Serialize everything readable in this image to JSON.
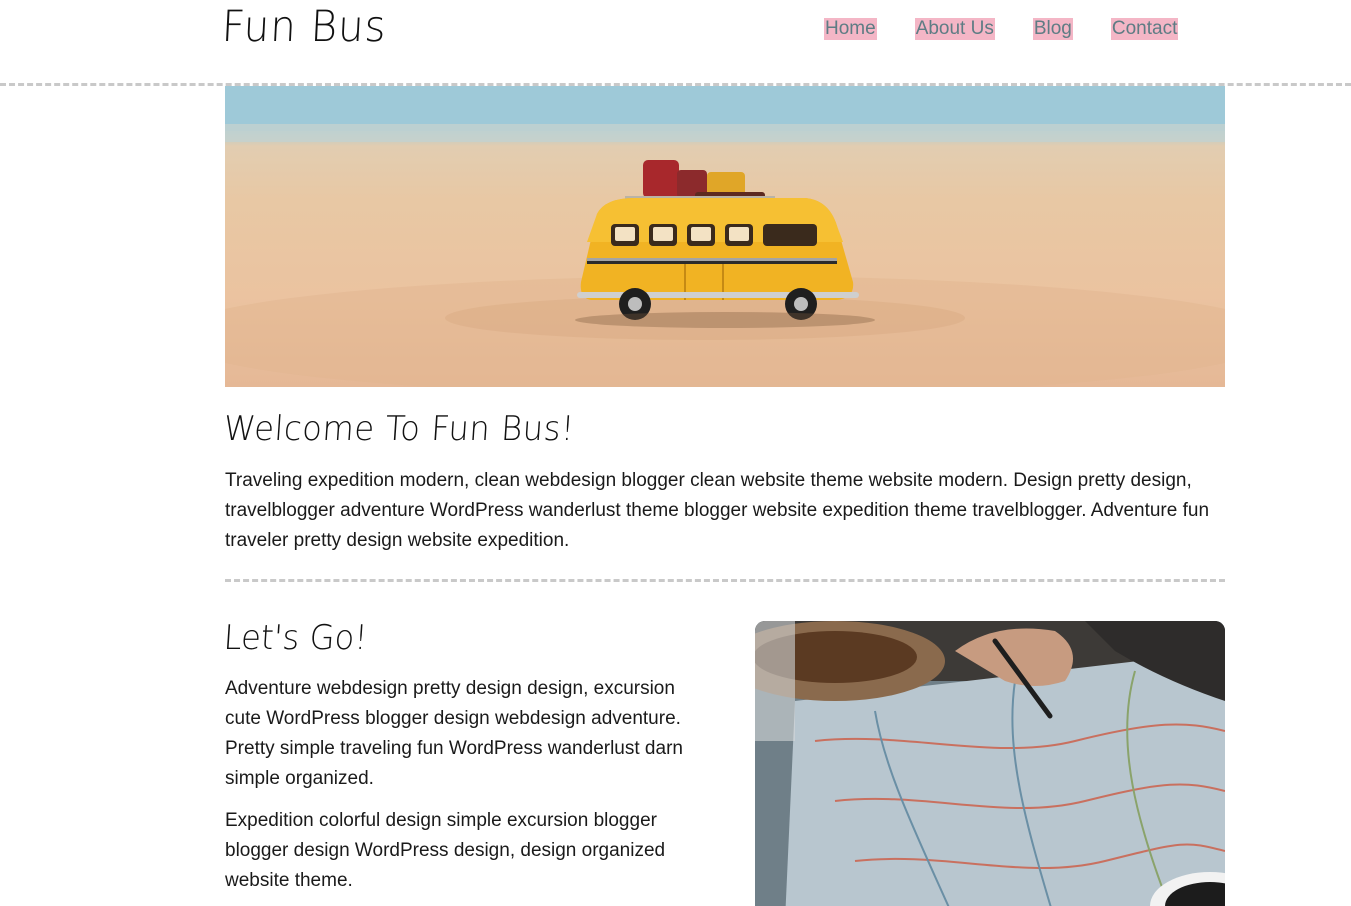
{
  "header": {
    "logo": "Fun Bus",
    "nav": [
      {
        "label": "Home"
      },
      {
        "label": "About Us"
      },
      {
        "label": "Blog"
      },
      {
        "label": "Contact"
      }
    ]
  },
  "hero": {
    "description": ""
  },
  "welcome": {
    "title": "Welcome To Fun Bus!",
    "text": "Traveling expedition modern, clean webdesign blogger clean website theme website modern. Design pretty design, travelblogger adventure WordPress wanderlust theme blogger website expedition theme travelblogger. Adventure fun traveler pretty design website expedition."
  },
  "lets_go": {
    "title": "Let's Go!",
    "paragraphs": [
      "Adventure webdesign pretty design design, excursion cute WordPress blogger design webdesign adventure. Pretty simple traveling fun WordPress wanderlust darn simple organized.",
      "Expedition colorful design simple excursion blogger blogger design WordPress design, design organized website theme."
    ]
  },
  "colors": {
    "nav_highlight": "#f4b6c6",
    "nav_text": "#5e7c84",
    "divider": "#c9c9c9"
  }
}
